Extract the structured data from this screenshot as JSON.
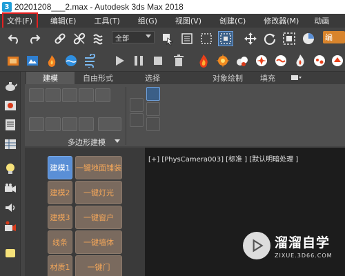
{
  "window": {
    "app_icon_label": "3",
    "title": "20201208___2.max - Autodesk 3ds Max 2018"
  },
  "menu": {
    "items": [
      {
        "label": "文件(F)",
        "highlighted": true
      },
      {
        "label": "编辑(E)"
      },
      {
        "label": "工具(T)"
      },
      {
        "label": "组(G)"
      },
      {
        "label": "视图(V)"
      },
      {
        "label": "创建(C)"
      },
      {
        "label": "修改器(M)"
      },
      {
        "label": "动画"
      }
    ],
    "highlight_color": "#e62020"
  },
  "toolbar": {
    "selection_filter": "全部",
    "edit_badge": "编",
    "icons_row1": [
      "undo-icon",
      "redo-icon",
      "link-icon",
      "unlink-icon",
      "bind-space-warp-icon",
      "select-object-icon",
      "select-by-name-icon",
      "rect-region-icon",
      "window-crossing-icon",
      "move-icon",
      "rotate-icon",
      "scale-icon"
    ],
    "icons_row2": [
      "render-setup-icon",
      "material-editor-icon",
      "fire-icon",
      "water-icon",
      "wind-icon",
      "play-icon",
      "pause-icon",
      "stop-icon",
      "trash-icon",
      "effect-fire-icon",
      "effect-burst-icon",
      "effect-smoke-icon",
      "effect-spark-icon",
      "effect-water-icon",
      "effect-flame-icon",
      "effect-dust-icon"
    ],
    "accent_orange": "#d8842c"
  },
  "ribbon": {
    "tabs": [
      "建模",
      "自由形式",
      "选择",
      "对象绘制",
      "填充"
    ],
    "active_tab": "建模",
    "group_label": "多边形建模"
  },
  "plugin": {
    "left_buttons": [
      "建模1",
      "建模2",
      "建模3",
      "线条",
      "材质1"
    ],
    "right_buttons": [
      "一键地面铺装",
      "一键灯光",
      "一键窗户",
      "一键墙体",
      "一键门"
    ],
    "active_button": "建模1",
    "active_color": "#5a8fd6",
    "text_color": "#f2a65a"
  },
  "viewport": {
    "label": "[+] [PhysCamera003] [标准 ] [默认明暗处理 ]"
  },
  "watermark": {
    "name": "溜溜自学",
    "url": "ZIXUE.3D66.COM"
  }
}
